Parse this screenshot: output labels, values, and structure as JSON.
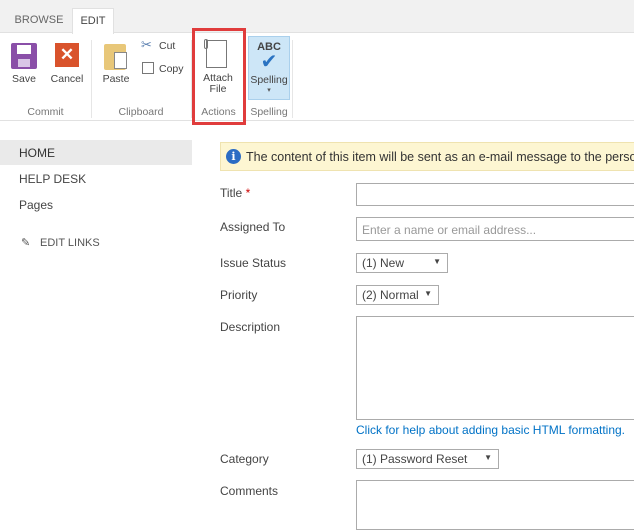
{
  "ribbon": {
    "tabs": [
      "BROWSE",
      "EDIT"
    ],
    "save": "Save",
    "cancel": "Cancel",
    "paste": "Paste",
    "cut": "Cut",
    "copy": "Copy",
    "attach_line1": "Attach",
    "attach_line2": "File",
    "spelling_abc": "ABC",
    "spelling": "Spelling",
    "groups": [
      "Commit",
      "Clipboard",
      "Actions",
      "Spelling"
    ]
  },
  "nav": {
    "items": [
      "HOME",
      "HELP DESK",
      "Pages"
    ],
    "edit_links": "EDIT LINKS"
  },
  "info": "The content of this item will be sent as an e-mail message to the person",
  "form": {
    "title_label": "Title",
    "required": "*",
    "assigned_label": "Assigned To",
    "assigned_placeholder": "Enter a name or email address...",
    "status_label": "Issue Status",
    "status_value": "(1) New",
    "priority_label": "Priority",
    "priority_value": "(2) Normal",
    "description_label": "Description",
    "html_help": "Click for help about adding basic HTML formatting.",
    "category_label": "Category",
    "category_value": "(1) Password Reset",
    "comments_label": "Comments"
  },
  "colors": {
    "highlight": "#e03c3c",
    "accent": "#0072c6",
    "info_bg": "#fdf6d2"
  }
}
